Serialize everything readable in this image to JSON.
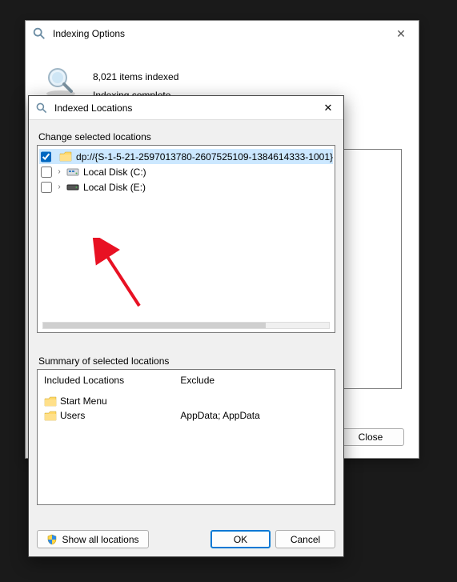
{
  "back_window": {
    "title": "Indexing Options",
    "items_indexed": "8,021 items indexed",
    "status": "Indexing complete.",
    "close_label": "Close"
  },
  "front_window": {
    "title": "Indexed Locations",
    "change_label": "Change selected locations",
    "tree": [
      {
        "checked": true,
        "expandable": false,
        "selected": true,
        "icon": "folder",
        "label": "dp://{S-1-5-21-2597013780-2607525109-1384614333-1001}"
      },
      {
        "checked": false,
        "expandable": true,
        "selected": false,
        "icon": "drive-c",
        "label": "Local Disk (C:)"
      },
      {
        "checked": false,
        "expandable": true,
        "selected": false,
        "icon": "drive-e",
        "label": "Local Disk (E:)"
      }
    ],
    "summary_label": "Summary of selected locations",
    "included_header": "Included Locations",
    "exclude_header": "Exclude",
    "included": [
      {
        "label": "Start Menu",
        "exclude": ""
      },
      {
        "label": "Users",
        "exclude": "AppData; AppData"
      }
    ],
    "show_all_label": "Show all locations",
    "ok_label": "OK",
    "cancel_label": "Cancel"
  }
}
